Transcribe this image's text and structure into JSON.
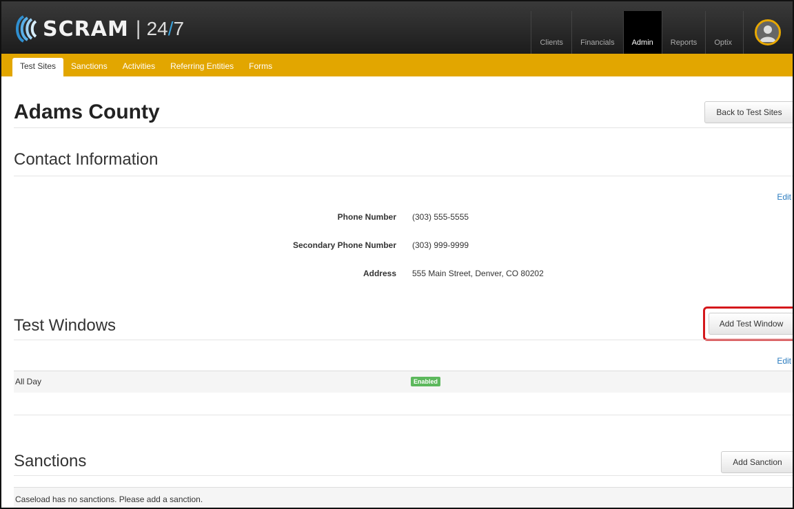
{
  "app": {
    "logo_text": "SCRAM",
    "logo_sep": "|",
    "logo_num_a": "24",
    "logo_num_slash": "/",
    "logo_num_b": "7",
    "brand_color": "#e2a600"
  },
  "topnav": {
    "items": [
      {
        "label": "Clients"
      },
      {
        "label": "Financials"
      },
      {
        "label": "Admin",
        "active": true
      },
      {
        "label": "Reports"
      },
      {
        "label": "Optix"
      }
    ]
  },
  "subnav": {
    "items": [
      {
        "label": "Test Sites",
        "active": true
      },
      {
        "label": "Sanctions"
      },
      {
        "label": "Activities"
      },
      {
        "label": "Referring Entities"
      },
      {
        "label": "Forms"
      }
    ]
  },
  "page": {
    "title": "Adams County",
    "back_button": "Back to Test Sites"
  },
  "contact": {
    "title": "Contact Information",
    "edit_label": "Edit",
    "fields": [
      {
        "label": "Phone Number",
        "value": "(303) 555-5555"
      },
      {
        "label": "Secondary Phone Number",
        "value": "(303) 999-9999"
      },
      {
        "label": "Address",
        "value": "555 Main Street, Denver, CO 80202"
      }
    ]
  },
  "test_windows": {
    "title": "Test Windows",
    "add_button": "Add Test Window",
    "edit_label": "Edit",
    "rows": [
      {
        "name": "All Day",
        "status": "Enabled",
        "status_color": "#5cb85c"
      }
    ]
  },
  "sanctions": {
    "title": "Sanctions",
    "add_button": "Add Sanction",
    "empty_text": "Caseload has no sanctions. Please add a sanction."
  }
}
